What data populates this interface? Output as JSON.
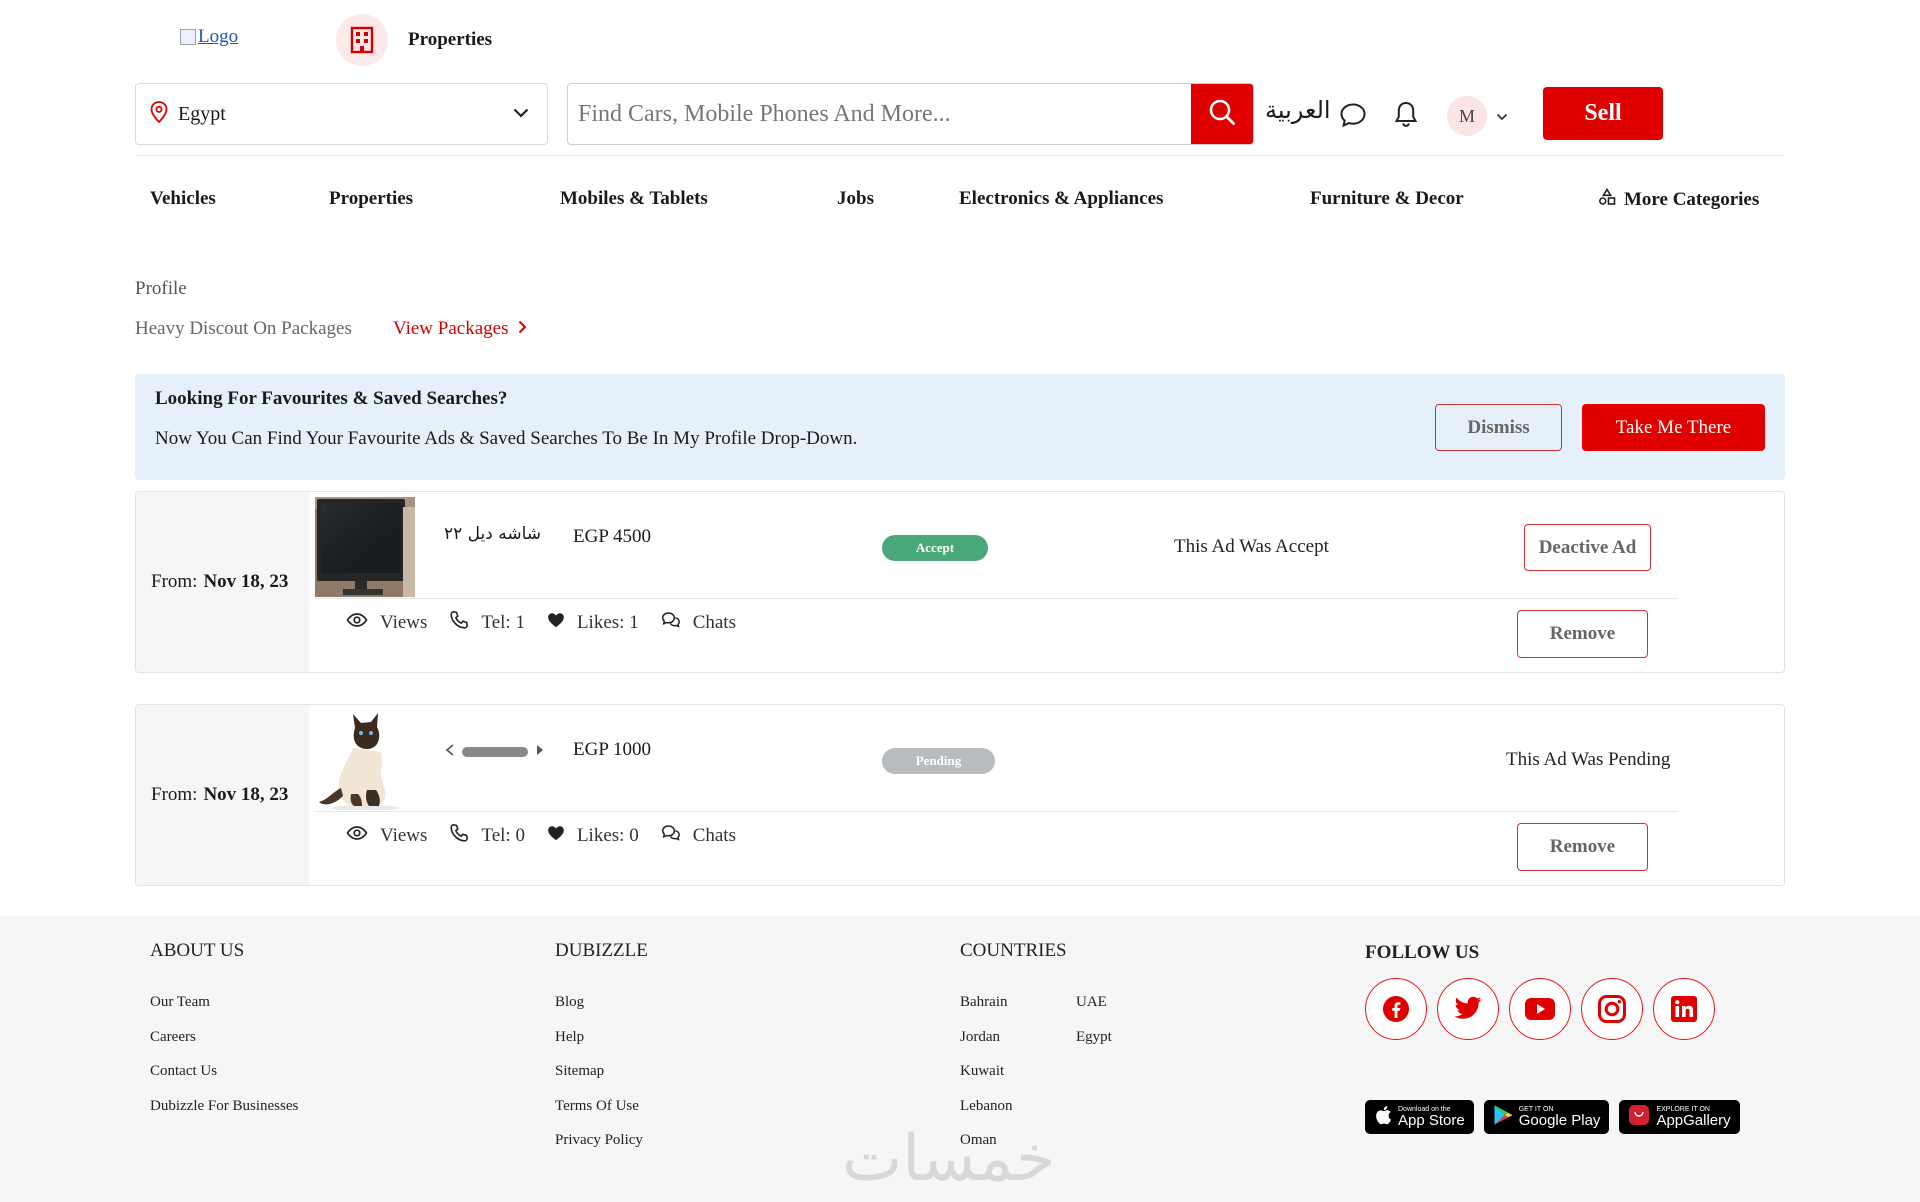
{
  "header": {
    "logo_alt": "Logo",
    "properties_shortcut": "Properties",
    "location": "Egypt",
    "search_placeholder": "Find Cars, Mobile Phones And More...",
    "language": "العربية",
    "avatar_initial": "M",
    "sell_label": "Sell"
  },
  "categories": [
    "Vehicles",
    "Properties",
    "Mobiles & Tablets",
    "Jobs",
    "Electronics & Appliances",
    "Furniture & Decor",
    "More Categories"
  ],
  "profile": {
    "label": "Profile",
    "discount_text": "Heavy Discout On Packages",
    "view_packages": "View Packages"
  },
  "notice": {
    "title": "Looking For Favourites & Saved Searches?",
    "text": "Now You Can Find Your Favourite Ads & Saved Searches To Be In My Profile Drop-Down.",
    "dismiss": "Dismiss",
    "take_me": "Take Me There"
  },
  "ads": [
    {
      "from_label": "From:",
      "date": "Nov 18, 23",
      "title": "شاشه ديل ٢٢",
      "price": "EGP 4500",
      "status": "Accept",
      "status_text": "This Ad Was Accept",
      "deactive_label": "Deactive Ad",
      "views": "Views",
      "tel": "Tel: 1",
      "likes": "Likes: 1",
      "chats": "Chats",
      "remove_label": "Remove"
    },
    {
      "from_label": "From:",
      "date": "Nov 18, 23",
      "price": "EGP 1000",
      "status": "Pending",
      "status_text": "This Ad Was Pending",
      "views": "Views",
      "tel": "Tel: 0",
      "likes": "Likes: 0",
      "chats": "Chats",
      "remove_label": "Remove"
    }
  ],
  "footer": {
    "about": {
      "heading": "ABOUT US",
      "links": [
        "Our Team",
        "Careers",
        "Contact Us",
        "Dubizzle For Businesses"
      ]
    },
    "dubizzle": {
      "heading": "DUBIZZLE",
      "links": [
        "Blog",
        "Help",
        "Sitemap",
        "Terms Of Use",
        "Privacy Policy"
      ]
    },
    "countries": {
      "heading": "COUNTRIES",
      "col1": [
        "Bahrain",
        "Jordan",
        "Kuwait",
        "Lebanon",
        "Oman"
      ],
      "col2": [
        "UAE",
        "Egypt"
      ]
    },
    "follow": {
      "heading": "FOLLOW US"
    },
    "stores": [
      {
        "small": "Download on the",
        "big": "App Store"
      },
      {
        "small": "GET IT ON",
        "big": "Google Play"
      },
      {
        "small": "EXPLORE IT ON",
        "big": "AppGallery"
      }
    ]
  },
  "watermark": "خمسات",
  "colors": {
    "brand_red": "#e00000",
    "accept_green": "#4aa77a",
    "pending_gray": "#b8bcbf",
    "notice_bg": "#e6f0fb"
  },
  "icons": [
    "location-pin-icon",
    "chevron-down-icon",
    "search-icon",
    "chat-bubble-icon",
    "bell-icon",
    "building-icon",
    "shapes-icon",
    "chevron-right-icon",
    "eye-icon",
    "phone-icon",
    "heart-icon",
    "chats-icon",
    "facebook-icon",
    "twitter-icon",
    "youtube-icon",
    "instagram-icon",
    "linkedin-icon",
    "apple-icon",
    "google-play-icon",
    "huawei-icon"
  ]
}
